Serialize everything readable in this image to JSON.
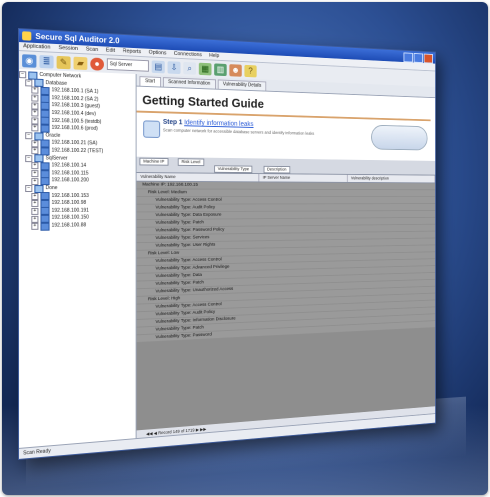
{
  "window": {
    "title": "Secure Sql Auditor 2.0"
  },
  "menu": [
    "Application",
    "Session",
    "Scan",
    "Edit",
    "Reports",
    "Options",
    "Connections",
    "Help"
  ],
  "toolbar": {
    "select_value": "Sql Server",
    "icons": [
      "scan-icon",
      "database-icon",
      "tools-icon",
      "folder-icon",
      "stop-icon",
      "report-icon",
      "export-icon",
      "magnify-icon",
      "grid-icon",
      "chart-icon",
      "users-icon",
      "help-icon"
    ]
  },
  "tree": [
    {
      "label": "Computer Network",
      "type": "root"
    },
    {
      "label": "Database",
      "type": "group"
    },
    {
      "label": "192.168.100.1 (SA 1)",
      "type": "node"
    },
    {
      "label": "192.168.100.2 (SA 2)",
      "type": "node"
    },
    {
      "label": "192.168.100.3 (guest)",
      "type": "node"
    },
    {
      "label": "192.168.100.4 (dev)",
      "type": "node"
    },
    {
      "label": "192.168.100.5 (testdb)",
      "type": "node"
    },
    {
      "label": "192.168.100.6 (prod)",
      "type": "node"
    },
    {
      "label": "Oracle",
      "type": "group"
    },
    {
      "label": "192.168.100.21 (SA)",
      "type": "node"
    },
    {
      "label": "192.168.100.22 (TEST)",
      "type": "node"
    },
    {
      "label": "SqlServer",
      "type": "group"
    },
    {
      "label": "192.168.100.14",
      "type": "node"
    },
    {
      "label": "192.168.100.115",
      "type": "node"
    },
    {
      "label": "192.168.100.200",
      "type": "node"
    },
    {
      "label": "Done",
      "type": "group"
    },
    {
      "label": "192.168.100.153",
      "type": "node"
    },
    {
      "label": "192.168.100.98",
      "type": "node"
    },
    {
      "label": "192.168.100.191",
      "type": "node"
    },
    {
      "label": "192.168.100.150",
      "type": "node"
    },
    {
      "label": "192.168.100.88",
      "type": "node"
    }
  ],
  "tabs": [
    "Start",
    "Scanned Information",
    "Vulnerability Details"
  ],
  "guide": {
    "title": "Getting Started Guide",
    "step_title": "Step 1",
    "step_link": "Identify information leaks",
    "step_desc": "Scan computer network for accessible database servers and identify information leaks"
  },
  "filters": [
    "Machine IP",
    "Risk Level",
    "Vulnerability Type",
    "Description"
  ],
  "columns": [
    "Vulnerability Name",
    "IP Server Name",
    "Vulnerability description"
  ],
  "rows": [
    {
      "text": "Machine IP: 192.168.100.15",
      "level": 0
    },
    {
      "text": "Risk Level: Medium",
      "level": 1
    },
    {
      "text": "Vulnerability Type: Access Control",
      "level": 2
    },
    {
      "text": "Vulnerability Type: Audit Policy",
      "level": 2
    },
    {
      "text": "Vulnerability Type: Data Exposure",
      "level": 2
    },
    {
      "text": "Vulnerability Type: Patch",
      "level": 2
    },
    {
      "text": "Vulnerability Type: Password Policy",
      "level": 2
    },
    {
      "text": "Vulnerability Type: Services",
      "level": 2
    },
    {
      "text": "Vulnerability Type: User Rights",
      "level": 2
    },
    {
      "text": "Risk Level: Low",
      "level": 1
    },
    {
      "text": "Vulnerability Type: Access Control",
      "level": 2
    },
    {
      "text": "Vulnerability Type: Advanced Privilege",
      "level": 2
    },
    {
      "text": "Vulnerability Type: Data",
      "level": 2
    },
    {
      "text": "Vulnerability Type: Patch",
      "level": 2
    },
    {
      "text": "Vulnerability Type: Unauthorized Access",
      "level": 2
    },
    {
      "text": "Risk Level: High",
      "level": 1
    },
    {
      "text": "Vulnerability Type: Access Control",
      "level": 2
    },
    {
      "text": "Vulnerability Type: Audit Policy",
      "level": 2
    },
    {
      "text": "Vulnerability Type: Information Disclosure",
      "level": 2
    },
    {
      "text": "Vulnerability Type: Patch",
      "level": 2
    },
    {
      "text": "Vulnerability Type: Password",
      "level": 2
    }
  ],
  "pager": "Record 149 of 1719",
  "status": "Scan Ready"
}
